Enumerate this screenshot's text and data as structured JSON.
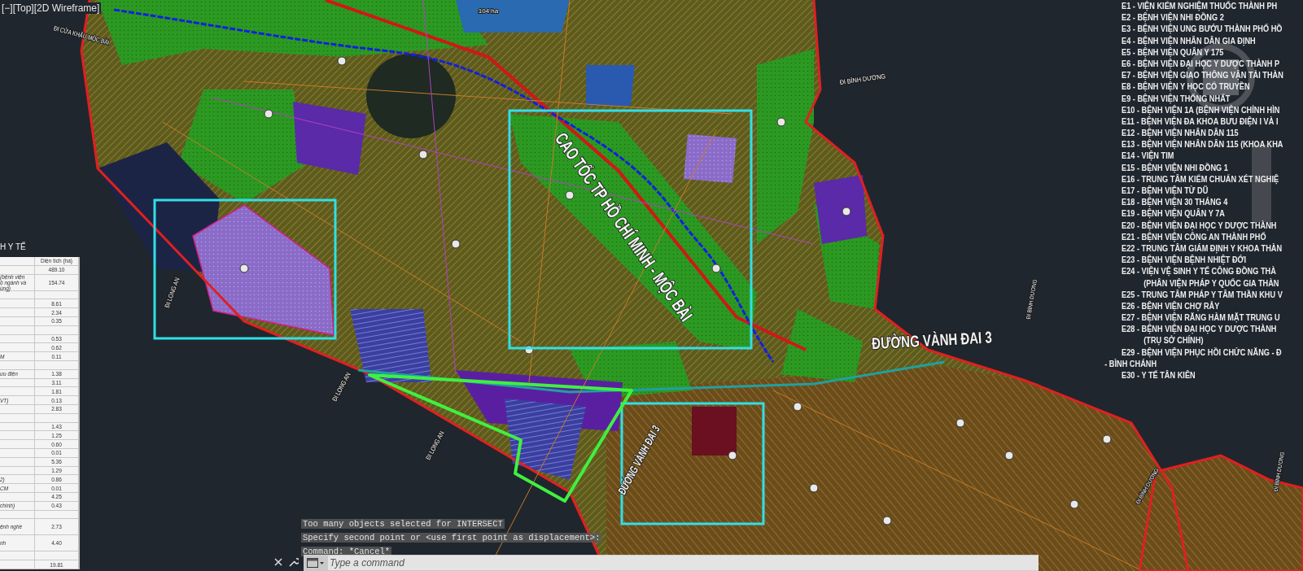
{
  "viewport_label": "[−][Top][2D Wireframe]",
  "map": {
    "labels": [
      {
        "text": "CAO TỐC TP HỒ CHÍ MINH - MỘC BÀI",
        "kind": "highway"
      },
      {
        "text": "ĐƯỜNG VÀNH ĐAI 3",
        "kind": "highway"
      },
      {
        "text": "ĐƯỜNG VÀNH ĐAI 3",
        "kind": "road"
      },
      {
        "text": "ĐI CỬA KHẨU MỘC BÀI",
        "kind": "direction"
      },
      {
        "text": "ĐI LONG AN",
        "kind": "direction"
      },
      {
        "text": "ĐI LONG AN",
        "kind": "direction"
      },
      {
        "text": "ĐI LONG AN",
        "kind": "direction"
      },
      {
        "text": "ĐI BÌNH DƯƠNG",
        "kind": "direction"
      },
      {
        "text": "ĐI BÌNH DƯƠNG",
        "kind": "direction"
      },
      {
        "text": "ĐI BÌNH DƯƠNG",
        "kind": "direction"
      },
      {
        "text": "ĐI BÌNH DƯƠNG",
        "kind": "direction"
      },
      {
        "text": "104 ha",
        "kind": "area"
      }
    ]
  },
  "area_table": {
    "title": "H Y TẾ",
    "header": "Diện tích (ha)",
    "total": "489.10",
    "rows": [
      {
        "kind": "tall",
        "label": "(bệnh viện\nộ ngành và\nùng)",
        "value": "154.74"
      },
      {
        "kind": "blank"
      },
      {
        "kind": "normal",
        "value": "8.61"
      },
      {
        "kind": "normal",
        "value": "2.34"
      },
      {
        "kind": "normal",
        "value": "0.35"
      },
      {
        "kind": "blank"
      },
      {
        "kind": "normal",
        "value": "0.53"
      },
      {
        "kind": "normal",
        "value": "0.62"
      },
      {
        "kind": "normal",
        "label": "M",
        "value": "0.11"
      },
      {
        "kind": "blank"
      },
      {
        "kind": "normal",
        "label": "ưu điện",
        "value": "1.38"
      },
      {
        "kind": "normal",
        "value": "3.11"
      },
      {
        "kind": "normal",
        "value": "1.81"
      },
      {
        "kind": "normal",
        "label": "VT)",
        "value": "0.13"
      },
      {
        "kind": "normal",
        "value": "2.83"
      },
      {
        "kind": "blank"
      },
      {
        "kind": "normal",
        "value": "1.43"
      },
      {
        "kind": "normal",
        "value": "1.25"
      },
      {
        "kind": "normal",
        "value": "0.60"
      },
      {
        "kind": "normal",
        "value": "0.01"
      },
      {
        "kind": "normal",
        "value": "5.36"
      },
      {
        "kind": "normal",
        "value": "1.29"
      },
      {
        "kind": "normal",
        "label": "2)",
        "value": "0.86"
      },
      {
        "kind": "normal",
        "label": "CM",
        "value": "0.01"
      },
      {
        "kind": "normal",
        "value": "4.25"
      },
      {
        "kind": "normal",
        "label": "chính)",
        "value": "0.43"
      },
      {
        "kind": "blank"
      },
      {
        "kind": "tall",
        "label": "ệnh nghề",
        "value": "2.73"
      },
      {
        "kind": "tall",
        "label": "nh",
        "value": "4.40"
      },
      {
        "kind": "blank"
      },
      {
        "kind": "normal",
        "value": "19.81"
      }
    ]
  },
  "legend": {
    "items": [
      {
        "kind": "entry",
        "text": "E1 - VIỆN KIỂM NGHIỆM THUỐC THÀNH PH"
      },
      {
        "kind": "entry",
        "text": "E2 - BỆNH VIỆN NHI ĐỒNG 2"
      },
      {
        "kind": "entry",
        "text": "E3 - BỆNH VIỆN UNG BƯỚU THÀNH PHỐ HỒ"
      },
      {
        "kind": "entry",
        "text": "E4 - BỆNH VIỆN NHÂN DÂN GIA ĐỊNH"
      },
      {
        "kind": "entry",
        "text": "E5 - BỆNH VIỆN QUÂN Y 175"
      },
      {
        "kind": "entry",
        "text": "E6 - BỆNH VIỆN ĐẠI HỌC Y DƯỢC THÀNH P"
      },
      {
        "kind": "entry",
        "text": "E7 - BỆNH VIỆN GIAO THÔNG VẬN TẢI THÀN"
      },
      {
        "kind": "entry",
        "text": "E8 - BỆNH VIỆN Y HỌC CỔ TRUYỀN"
      },
      {
        "kind": "entry",
        "text": "E9 - BỆNH VIỆN THỐNG NHẤT"
      },
      {
        "kind": "entry",
        "text": "E10 - BỆNH VIỆN 1A (BỆNH VIỆN CHỈNH HÌN"
      },
      {
        "kind": "entry",
        "text": "E11 - BỆNH VIỆN ĐA KHOA BƯU ĐIỆN I VÀ I"
      },
      {
        "kind": "entry",
        "text": "E12 - BỆNH VIỆN NHÂN DÂN 115"
      },
      {
        "kind": "entry",
        "text": "E13 - BỆNH VIỆN NHÂN DÂN 115 (KHOA KHA"
      },
      {
        "kind": "entry",
        "text": "E14 - VIỆN TIM"
      },
      {
        "kind": "entry",
        "text": "E15 - BỆNH VIỆN NHI ĐỒNG 1"
      },
      {
        "kind": "entry",
        "text": "E16 - TRUNG TÂM KIỂM CHUẨN XÉT NGHIỆ"
      },
      {
        "kind": "entry",
        "text": "E17 - BỆNH VIỆN TỪ DŨ"
      },
      {
        "kind": "entry",
        "text": "E18 - BỆNH VIỆN 30 THÁNG 4"
      },
      {
        "kind": "entry",
        "text": "E19 - BỆNH VIỆN QUÂN Y 7A"
      },
      {
        "kind": "entry",
        "text": "E20 - BỆNH VIỆN ĐẠI HỌC Y DƯỢC THÀNH"
      },
      {
        "kind": "entry",
        "text": "E21 - BỆNH VIỆN CÔNG AN THÀNH PHỐ"
      },
      {
        "kind": "entry",
        "text": "E22 - TRUNG TÂM GIÁM ĐỊNH Y KHOA THÀN"
      },
      {
        "kind": "entry",
        "text": "E23 - BỆNH VIỆN BỆNH NHIỆT ĐỚI"
      },
      {
        "kind": "entry",
        "text": "E24 - VIỆN VỆ SINH Y TẾ CÔNG ĐỒNG THÀ"
      },
      {
        "kind": "continuation",
        "text": "(PHÂN VIỆN PHÁP Y QUỐC GIA THÀN"
      },
      {
        "kind": "entry",
        "text": "E25 - TRUNG TÂM PHÁP Y TÂM THẦN KHU V"
      },
      {
        "kind": "entry",
        "text": "E26 - BỆNH VIỆN CHỢ RẪY"
      },
      {
        "kind": "entry",
        "text": "E27 - BỆNH VIỆN RĂNG HÀM MẶT TRUNG U"
      },
      {
        "kind": "entry",
        "text": "E28 - BỆNH VIỆN ĐẠI HỌC Y DƯỢC THÀNH"
      },
      {
        "kind": "continuation",
        "text": "(TRỤ SỞ CHÍNH)"
      },
      {
        "kind": "entry",
        "text": "E29 - BỆNH VIỆN PHỤC HỒI CHỨC NĂNG - Đ"
      },
      {
        "kind": "district",
        "text": "- BÌNH CHÁNH"
      },
      {
        "kind": "entry",
        "text": "E30 - Y TẾ TÂN KIÊN"
      }
    ]
  },
  "command_line": {
    "history": [
      "Too many objects selected for INTERSECT",
      "Specify second point or <use first point as displacement>:",
      "Command: *Cancel*"
    ],
    "placeholder": "Type a command"
  }
}
